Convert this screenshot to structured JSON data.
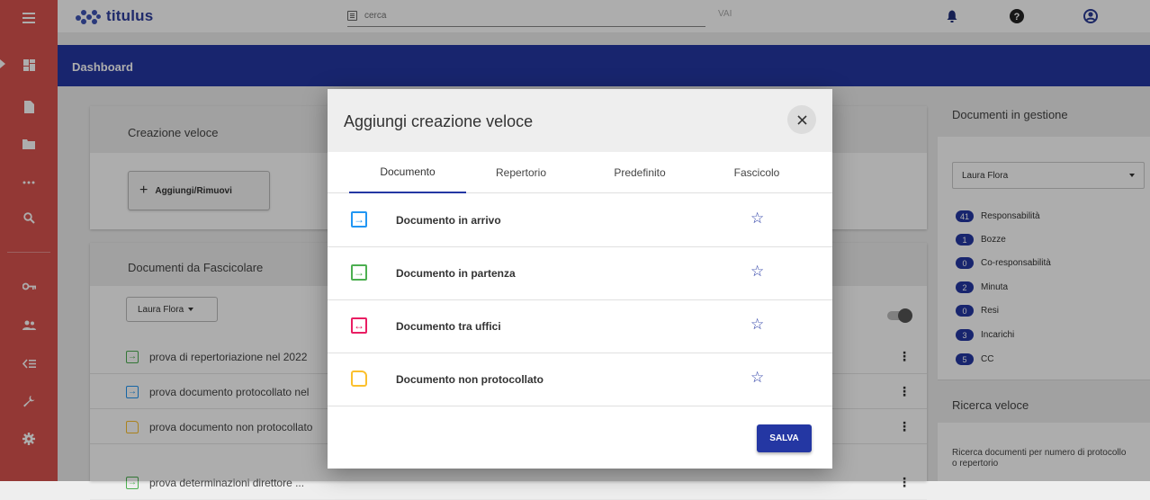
{
  "app": {
    "name": "titulus"
  },
  "search": {
    "placeholder": "cerca",
    "button": "VAI"
  },
  "rail": {
    "icons": [
      "menu-icon",
      "dashboard-icon",
      "document-icon",
      "folder-icon",
      "more-icon",
      "search-icon",
      "key-icon",
      "users-icon",
      "list-icon",
      "wrench-icon",
      "gear-icon"
    ]
  },
  "header": {
    "title": "Dashboard"
  },
  "quick_create_card": {
    "title": "Creazione veloce",
    "add_button": "Aggiungi/Rimuovi"
  },
  "to_file_card": {
    "title": "Documenti da Fascicolare",
    "user_filter": "Laura Flora",
    "rows": [
      {
        "label": "prova di repertoriazione nel 2022",
        "icon": "outgoing-doc-icon"
      },
      {
        "label": "prova documento protocollato nel",
        "icon": "incoming-doc-icon"
      },
      {
        "label": "prova documento non protocollato",
        "icon": "unregistered-doc-icon"
      },
      {
        "label": "prova determinazioni direttore ...",
        "icon": "outgoing-doc-icon"
      }
    ]
  },
  "right_panel": {
    "title": "Documenti in gestione",
    "user_select": "Laura Flora",
    "stats": [
      {
        "count": "41",
        "label": "Responsabilità"
      },
      {
        "count": "1",
        "label": "Bozze"
      },
      {
        "count": "0",
        "label": "Co-responsabilità"
      },
      {
        "count": "2",
        "label": "Minuta"
      },
      {
        "count": "0",
        "label": "Resi"
      },
      {
        "count": "3",
        "label": "Incarichi"
      },
      {
        "count": "5",
        "label": "CC"
      }
    ],
    "quick_search_title": "Ricerca veloce",
    "quick_search_text": "Ricerca documenti per numero di protocollo o repertorio"
  },
  "modal": {
    "title": "Aggiungi creazione veloce",
    "tabs": [
      "Documento",
      "Repertorio",
      "Predefinito",
      "Fascicolo"
    ],
    "active_tab": "Documento",
    "items": [
      {
        "label": "Documento in arrivo",
        "icon": "incoming-doc-icon",
        "glyph": "→"
      },
      {
        "label": "Documento in partenza",
        "icon": "outgoing-doc-icon",
        "glyph": "→"
      },
      {
        "label": "Documento tra uffici",
        "icon": "internal-doc-icon",
        "glyph": "↔"
      },
      {
        "label": "Documento non protocollato",
        "icon": "unregistered-doc-icon",
        "glyph": ""
      }
    ],
    "save_button": "SALVA"
  },
  "colors": {
    "primary": "#2437a3",
    "rail": "#d9534f",
    "incoming": "#2196f3",
    "outgoing": "#4caf50",
    "internal": "#e91e63",
    "unregistered": "#fbc02d"
  }
}
